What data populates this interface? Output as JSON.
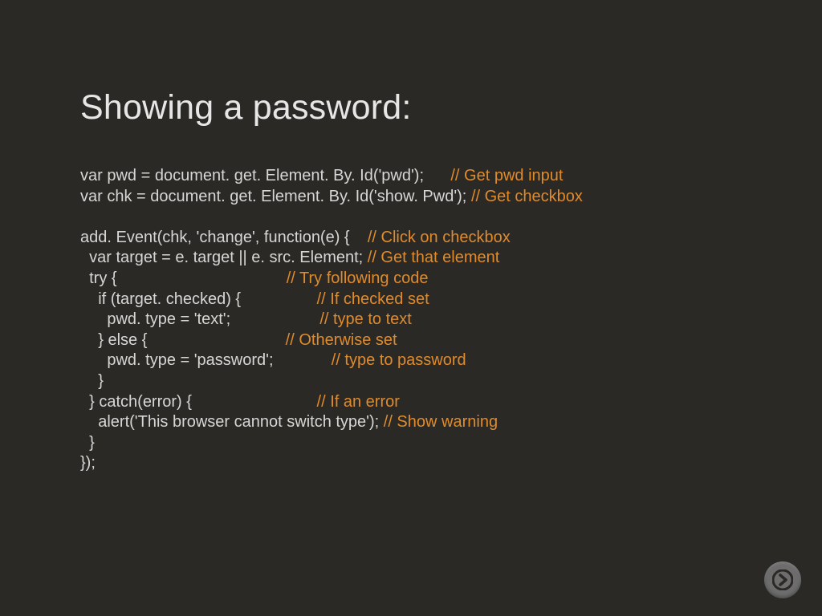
{
  "title": "Showing a password:",
  "code_lines": [
    {
      "code": "var pwd = document. get. Element. By. Id('pwd');      ",
      "comment": "// Get pwd input"
    },
    {
      "code": "var chk = document. get. Element. By. Id('show. Pwd'); ",
      "comment": "// Get checkbox"
    },
    {
      "code": "",
      "comment": ""
    },
    {
      "code": "add. Event(chk, 'change', function(e) {    ",
      "comment": "// Click on checkbox"
    },
    {
      "code": "  var target = e. target || e. src. Element; ",
      "comment": "// Get that element"
    },
    {
      "code": "  try {                                      ",
      "comment": "// Try following code"
    },
    {
      "code": "    if (target. checked) {                 ",
      "comment": "// If checked set"
    },
    {
      "code": "      pwd. type = 'text';                    ",
      "comment": "// type to text"
    },
    {
      "code": "    } else {                               ",
      "comment": "// Otherwise set"
    },
    {
      "code": "      pwd. type = 'password';             ",
      "comment": "// type to password"
    },
    {
      "code": "    }",
      "comment": ""
    },
    {
      "code": "  } catch(error) {                            ",
      "comment": "// If an error"
    },
    {
      "code": "    alert('This browser cannot switch type'); ",
      "comment": "// Show warning"
    },
    {
      "code": "  }",
      "comment": ""
    },
    {
      "code": "});",
      "comment": ""
    }
  ],
  "nav": {
    "next_label": "next"
  }
}
